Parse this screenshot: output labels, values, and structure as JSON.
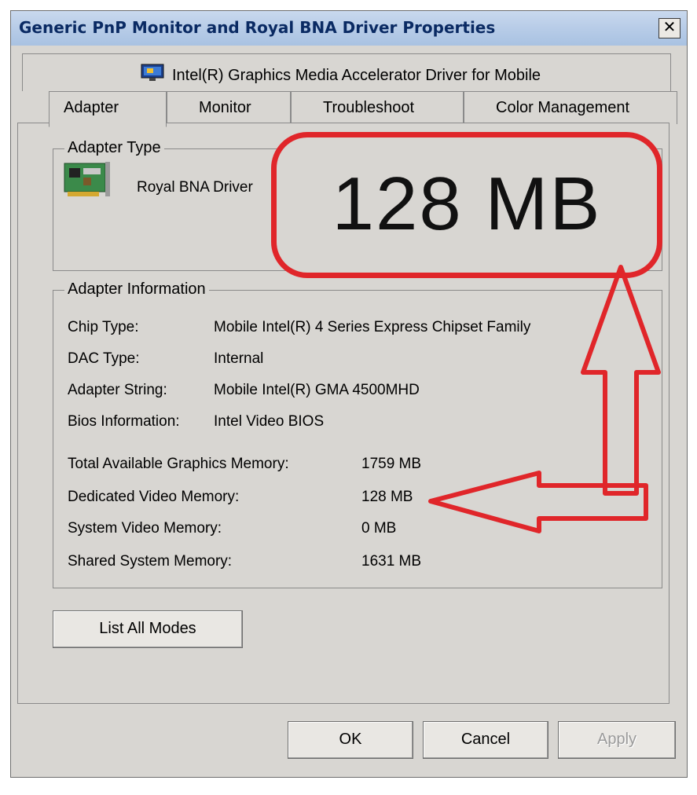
{
  "window": {
    "title": "Generic PnP Monitor and Royal BNA Driver Properties",
    "close_label": "✕"
  },
  "tabs": {
    "top": {
      "label": "Intel(R) Graphics Media Accelerator Driver for Mobile",
      "icon": "intel-graphics-icon"
    },
    "items": [
      {
        "label": "Adapter",
        "active": true
      },
      {
        "label": "Monitor",
        "active": false
      },
      {
        "label": "Troubleshoot",
        "active": false
      },
      {
        "label": "Color Management",
        "active": false
      }
    ]
  },
  "adapter_type": {
    "title": "Adapter Type",
    "name": "Royal BNA Driver",
    "icon": "graphics-card-icon"
  },
  "adapter_info": {
    "title": "Adapter Information",
    "chip_type_label": "Chip Type:",
    "chip_type_value": "Mobile Intel(R) 4 Series Express Chipset Family",
    "dac_type_label": "DAC Type:",
    "dac_type_value": "Internal",
    "adapter_string_label": "Adapter String:",
    "adapter_string_value": "Mobile Intel(R) GMA 4500MHD",
    "bios_label": "Bios Information:",
    "bios_value": "Intel Video BIOS",
    "total_mem_label": "Total Available Graphics Memory:",
    "total_mem_value": "1759 MB",
    "dedicated_label": "Dedicated Video Memory:",
    "dedicated_value": "128 MB",
    "system_video_label": "System Video Memory:",
    "system_video_value": "0 MB",
    "shared_label": "Shared System Memory:",
    "shared_value": "1631 MB"
  },
  "annotation": {
    "zoom_text": "128 MB",
    "color": "#e0262a"
  },
  "buttons": {
    "list_modes": "List All Modes",
    "ok": "OK",
    "cancel": "Cancel",
    "apply": "Apply"
  }
}
